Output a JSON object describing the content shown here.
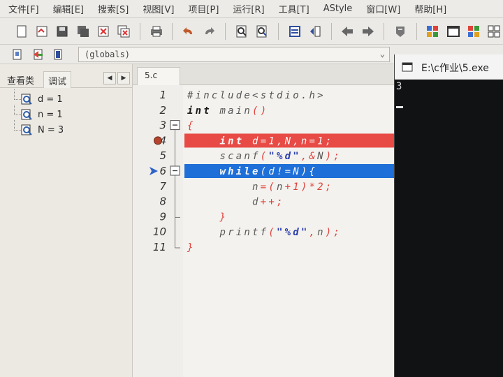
{
  "menu": [
    "文件[F]",
    "编辑[E]",
    "搜索[S]",
    "视图[V]",
    "项目[P]",
    "运行[R]",
    "工具[T]",
    "AStyle",
    "窗口[W]",
    "帮助[H]"
  ],
  "toolbar": {
    "buttons": [
      {
        "icon": "new-file-icon"
      },
      {
        "icon": "open-file-icon"
      },
      {
        "icon": "save-icon"
      },
      {
        "icon": "save-all-icon"
      },
      {
        "icon": "close-file-icon"
      },
      {
        "icon": "close-all-icon"
      },
      {
        "sep": true
      },
      {
        "icon": "print-icon"
      },
      {
        "sep": true
      },
      {
        "icon": "undo-icon"
      },
      {
        "icon": "redo-icon"
      },
      {
        "sep": true
      },
      {
        "icon": "find-icon"
      },
      {
        "icon": "replace-icon"
      },
      {
        "sep": true
      },
      {
        "icon": "indent-icon"
      },
      {
        "icon": "unindent-icon"
      },
      {
        "sep": true
      },
      {
        "icon": "back-icon"
      },
      {
        "icon": "forward-icon"
      },
      {
        "sep": true
      },
      {
        "icon": "bookmark-icon"
      },
      {
        "sep": true
      },
      {
        "icon": "compile-icon"
      },
      {
        "icon": "run-icon"
      },
      {
        "icon": "compile-run-icon"
      },
      {
        "icon": "rebuild-icon"
      }
    ]
  },
  "combo": {
    "value": "(globals)"
  },
  "left_panel": {
    "tabs": [
      "查看类",
      "调试"
    ],
    "active_tab": "调试",
    "watches": [
      "d = 1",
      "n = 1",
      "N = 3"
    ]
  },
  "editor": {
    "file_tab": "5.c",
    "line_numbers": [
      "1",
      "2",
      "3",
      "4",
      "5",
      "6",
      "7",
      "8",
      "9",
      "10",
      "11"
    ],
    "lines": [
      "#include<stdio.h>",
      "int main()",
      "{",
      "    int d=1,N,n=1;",
      "    scanf(\"%d\",&N);",
      "    while(d!=N){",
      "        n=(n+1)*2;",
      "        d++;",
      "    }",
      "    printf(\"%d\",n);",
      "}"
    ],
    "breakpoint_line": 4,
    "current_line": 6,
    "colors": {
      "keyword": "#1a1a1a",
      "text": "#5a5a5a",
      "symbol": "#e0413a",
      "string": "#2d3fb0",
      "breakpoint_bg": "#e84a45",
      "current_bg": "#1e6fd8"
    }
  },
  "console": {
    "title": "E:\\c作业\\5.exe",
    "output": "3"
  }
}
